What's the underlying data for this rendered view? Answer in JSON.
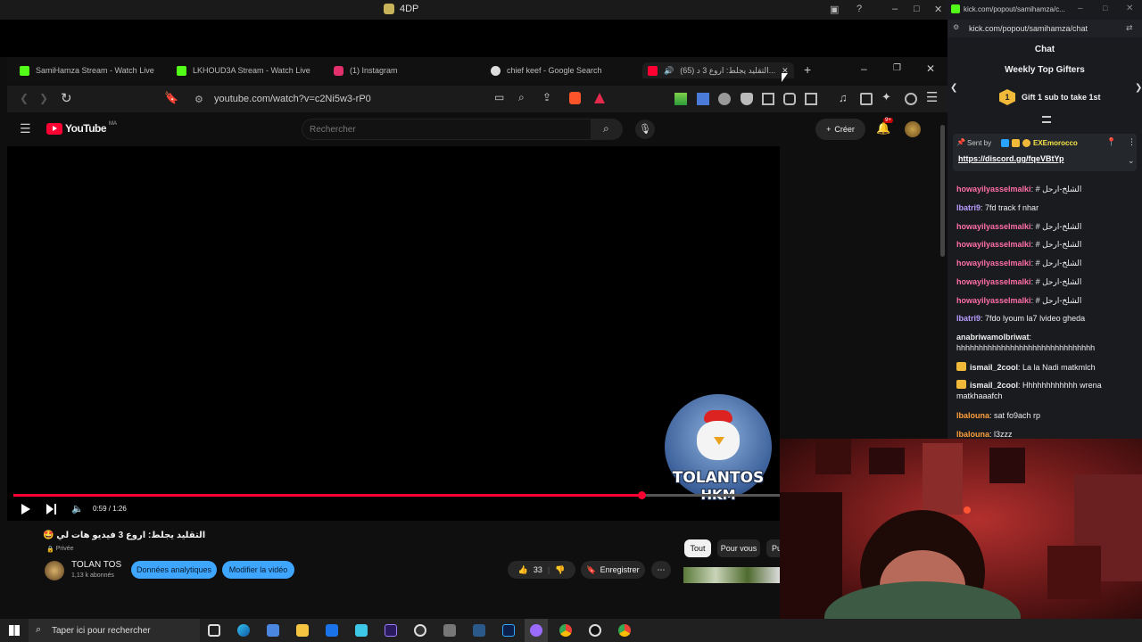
{
  "os": {
    "window_title": "4DP"
  },
  "browser": {
    "tabs": [
      {
        "label": "SamiHamza Stream - Watch Live",
        "color": "#53fc18"
      },
      {
        "label": "LKHOUD3A Stream - Watch Live",
        "color": "#53fc18"
      },
      {
        "label": "(1) Instagram",
        "color": "#e1306c"
      },
      {
        "label": "chief keef - Google Search",
        "color": "#dddddd"
      },
      {
        "label": "(65) التقليد يجلط: اروع 3 د...",
        "color": "#ff0033"
      }
    ],
    "url": "youtube.com/watch?v=c2Ni5w3-rP0"
  },
  "youtube": {
    "logo": "YouTube",
    "region": "MA",
    "search_placeholder": "Rechercher",
    "create_label": "Créer",
    "notif_count": "9+",
    "time": "0:59 / 1:26",
    "progress": 0.82,
    "video_title": "التقليد يجلط: اروع 3 فيديو هات لي 🤩",
    "privacy": "Privée",
    "channel_name": "TOLAN TOS",
    "subscribers": "1,13 k abonnés",
    "analytics_label": "Données analytiques",
    "edit_label": "Modifier la vidéo",
    "likes": "33",
    "save_label": "Enregistrer",
    "chips": [
      "Tout",
      "Pour vous",
      "Pu"
    ],
    "watermark_line1": "TOLANTOS",
    "watermark_line2": "HKM"
  },
  "chat": {
    "url": "kick.com/popout/samihamza/chat",
    "window_url": "kick.com/popout/samihamza/c...",
    "header": "Chat",
    "gifters_title": "Weekly Top Gifters",
    "gift_text": "Gift 1 sub to take 1st",
    "gift_rank": "1",
    "pinned_by_label": "Sent by",
    "pinned_by_user": "EXEmorocco",
    "pinned_link": "https://discord.gg/fqeVBtYp",
    "messages": [
      {
        "user": "howayilyasselmalki",
        "color": "#ff6fa8",
        "text": "# الشلخ-ارحل"
      },
      {
        "user": "lbatri9",
        "color": "#b89cff",
        "text": "7fd track f nhar"
      },
      {
        "user": "howayilyasselmalki",
        "color": "#ff6fa8",
        "text": "# الشلخ-ارحل"
      },
      {
        "user": "howayilyasselmalki",
        "color": "#ff6fa8",
        "text": "# الشلخ-ارحل"
      },
      {
        "user": "howayilyasselmalki",
        "color": "#ff6fa8",
        "text": "# الشلخ-ارحل"
      },
      {
        "user": "howayilyasselmalki",
        "color": "#ff6fa8",
        "text": "# الشلخ-ارحل"
      },
      {
        "user": "howayilyasselmalki",
        "color": "#ff6fa8",
        "text": "# الشلخ-ارحل"
      },
      {
        "user": "lbatri9",
        "color": "#b89cff",
        "text": "7fdo lyoum la7 lvideo gheda"
      },
      {
        "user": "anabriwamolbriwat",
        "color": "#eeeeee",
        "text": "hhhhhhhhhhhhhhhhhhhhhhhhhhhhhhh"
      },
      {
        "user": "ismail_2cool",
        "color": "#eeeeee",
        "text": "La la Nadi matkmlch"
      },
      {
        "user": "ismail_2cool",
        "color": "#eeeeee",
        "text": "Hhhhhhhhhhhh wrena matkhaaafch"
      },
      {
        "user": "lbalouna",
        "color": "#ff9f3a",
        "text": "sat fo9ach rp"
      },
      {
        "user": "lbalouna",
        "color": "#ff9f3a",
        "text": "l3zzz"
      }
    ]
  },
  "taskbar": {
    "search_placeholder": "Taper ici pour rechercher"
  }
}
